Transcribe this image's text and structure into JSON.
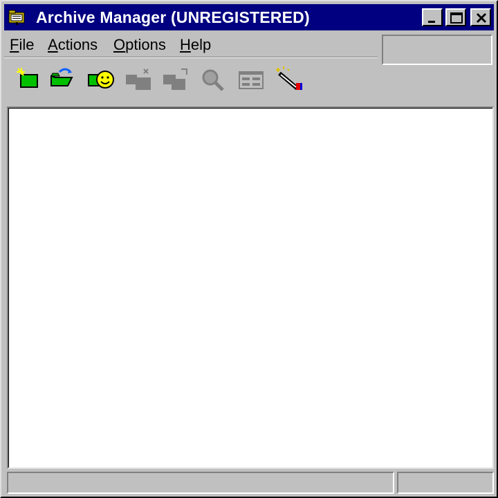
{
  "window": {
    "title": "Archive Manager (UNREGISTERED)",
    "title_bar_color": "#000080",
    "icons": {
      "app": "archive-folder-icon",
      "minimize": "minimize-icon",
      "maximize": "maximize-icon",
      "close": "close-icon"
    }
  },
  "menu": {
    "items": [
      {
        "label": "File"
      },
      {
        "label": "Actions"
      },
      {
        "label": "Options"
      },
      {
        "label": "Help"
      }
    ]
  },
  "toolbar": {
    "buttons": [
      {
        "icon": "new-archive-icon",
        "enabled": true
      },
      {
        "icon": "open-archive-icon",
        "enabled": true
      },
      {
        "icon": "smiley-wizard-icon",
        "enabled": true
      },
      {
        "icon": "add-files-icon",
        "enabled": false
      },
      {
        "icon": "extract-files-icon",
        "enabled": false
      },
      {
        "icon": "view-file-icon",
        "enabled": false
      },
      {
        "icon": "properties-icon",
        "enabled": false
      },
      {
        "icon": "wand-icon",
        "enabled": true
      }
    ]
  },
  "status_bar": {
    "left_text": "",
    "right_text": ""
  }
}
